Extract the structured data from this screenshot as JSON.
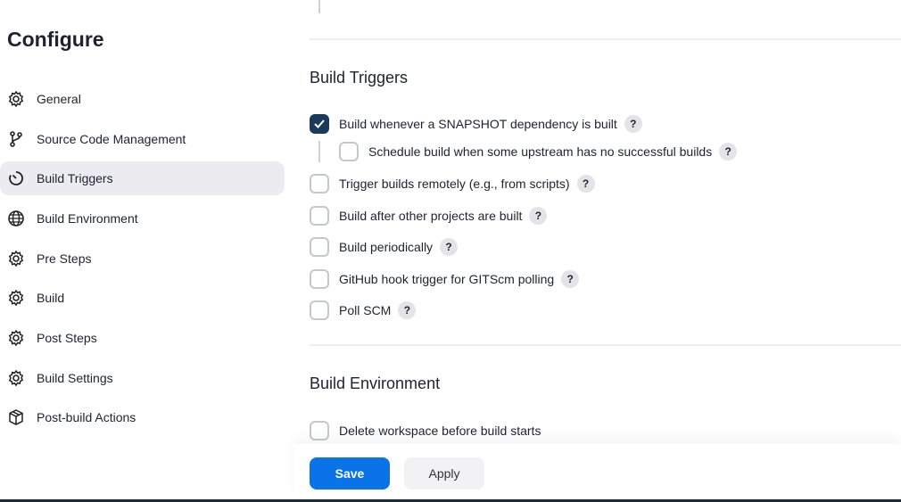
{
  "sidebar": {
    "title": "Configure",
    "items": [
      {
        "label": "General",
        "icon": "gear-icon"
      },
      {
        "label": "Source Code Management",
        "icon": "branch-icon"
      },
      {
        "label": "Build Triggers",
        "icon": "timer-icon",
        "active": true
      },
      {
        "label": "Build Environment",
        "icon": "globe-icon"
      },
      {
        "label": "Pre Steps",
        "icon": "gear-icon"
      },
      {
        "label": "Build",
        "icon": "gear-icon"
      },
      {
        "label": "Post Steps",
        "icon": "gear-icon"
      },
      {
        "label": "Build Settings",
        "icon": "gear-icon"
      },
      {
        "label": "Post-build Actions",
        "icon": "package-icon"
      }
    ]
  },
  "triggers": {
    "heading": "Build Triggers",
    "help": "?",
    "options": [
      {
        "label": "Build whenever a SNAPSHOT dependency is built",
        "checked": true
      },
      {
        "label": "Schedule build when some upstream has no successful builds",
        "checked": false
      },
      {
        "label": "Trigger builds remotely (e.g., from scripts)",
        "checked": false
      },
      {
        "label": "Build after other projects are built",
        "checked": false
      },
      {
        "label": "Build periodically",
        "checked": false
      },
      {
        "label": "GitHub hook trigger for GITScm polling",
        "checked": false
      },
      {
        "label": "Poll SCM",
        "checked": false
      }
    ]
  },
  "environment": {
    "heading": "Build Environment",
    "options": [
      {
        "label": "Delete workspace before build starts",
        "checked": false
      }
    ]
  },
  "actions": {
    "save": "Save",
    "apply": "Apply"
  },
  "colors": {
    "accent": "#0b73e8",
    "checked": "#1a3a5a"
  }
}
